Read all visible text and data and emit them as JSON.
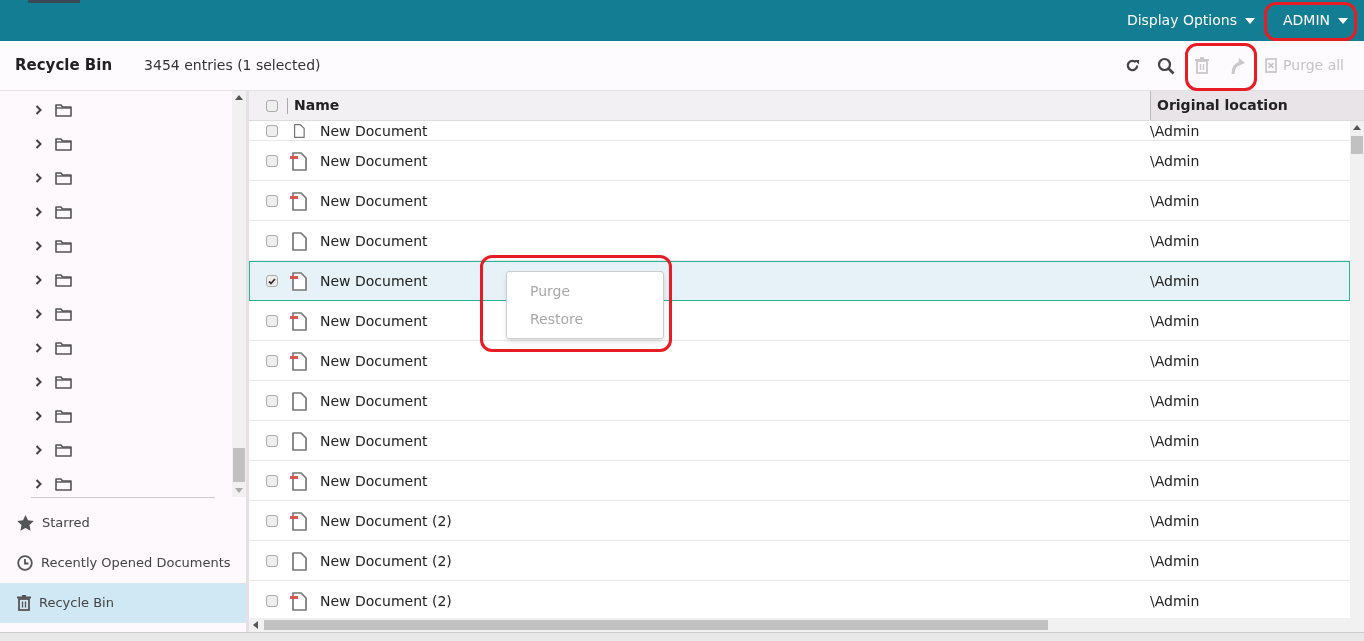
{
  "top_bar": {
    "display_options": "Display Options",
    "user": "ADMIN"
  },
  "toolbar": {
    "title": "Recycle Bin",
    "count": "3454 entries (1 selected)",
    "purge_enabled": false,
    "restore_enabled": false,
    "purge_all": {
      "label": "Purge all",
      "disabled": true
    }
  },
  "folders": [
    {
      "expanded": false
    },
    {
      "expanded": false
    },
    {
      "expanded": false
    },
    {
      "expanded": false
    },
    {
      "expanded": false
    },
    {
      "expanded": false
    },
    {
      "expanded": false
    },
    {
      "expanded": false
    },
    {
      "expanded": false
    },
    {
      "expanded": false
    },
    {
      "expanded": false
    },
    {
      "expanded": false
    }
  ],
  "nav": [
    {
      "kind": "star",
      "label": "Starred",
      "selected": false
    },
    {
      "kind": "clock",
      "label": "Recently Opened Documents",
      "selected": false
    },
    {
      "kind": "trash",
      "label": "Recycle Bin",
      "selected": true
    }
  ],
  "table": {
    "columns": [
      "Name",
      "Original location"
    ],
    "select_all_checked": false,
    "rows": [
      {
        "kind": "plain",
        "name": "New Document",
        "location": "\\Admin",
        "checked": false,
        "selected": false
      },
      {
        "kind": "flagged",
        "name": "New Document",
        "location": "\\Admin",
        "checked": false,
        "selected": false
      },
      {
        "kind": "flagged",
        "name": "New Document",
        "location": "\\Admin",
        "checked": false,
        "selected": false
      },
      {
        "kind": "plain",
        "name": "New Document",
        "location": "\\Admin",
        "checked": false,
        "selected": false
      },
      {
        "kind": "flagged",
        "name": "New Document",
        "location": "\\Admin",
        "checked": true,
        "selected": true
      },
      {
        "kind": "flagged",
        "name": "New Document",
        "location": "\\Admin",
        "checked": false,
        "selected": false
      },
      {
        "kind": "flagged",
        "name": "New Document",
        "location": "\\Admin",
        "checked": false,
        "selected": false
      },
      {
        "kind": "plain",
        "name": "New Document",
        "location": "\\Admin",
        "checked": false,
        "selected": false
      },
      {
        "kind": "plain",
        "name": "New Document",
        "location": "\\Admin",
        "checked": false,
        "selected": false
      },
      {
        "kind": "flagged",
        "name": "New Document",
        "location": "\\Admin",
        "checked": false,
        "selected": false
      },
      {
        "kind": "flagged",
        "name": "New Document (2)",
        "location": "\\Admin",
        "checked": false,
        "selected": false
      },
      {
        "kind": "plain",
        "name": "New Document (2)",
        "location": "\\Admin",
        "checked": false,
        "selected": false
      },
      {
        "kind": "flagged",
        "name": "New Document (2)",
        "location": "\\Admin",
        "checked": false,
        "selected": false
      }
    ]
  },
  "context_menu": {
    "items": [
      {
        "label": "Purge",
        "disabled": true
      },
      {
        "label": "Restore",
        "disabled": true
      }
    ]
  }
}
